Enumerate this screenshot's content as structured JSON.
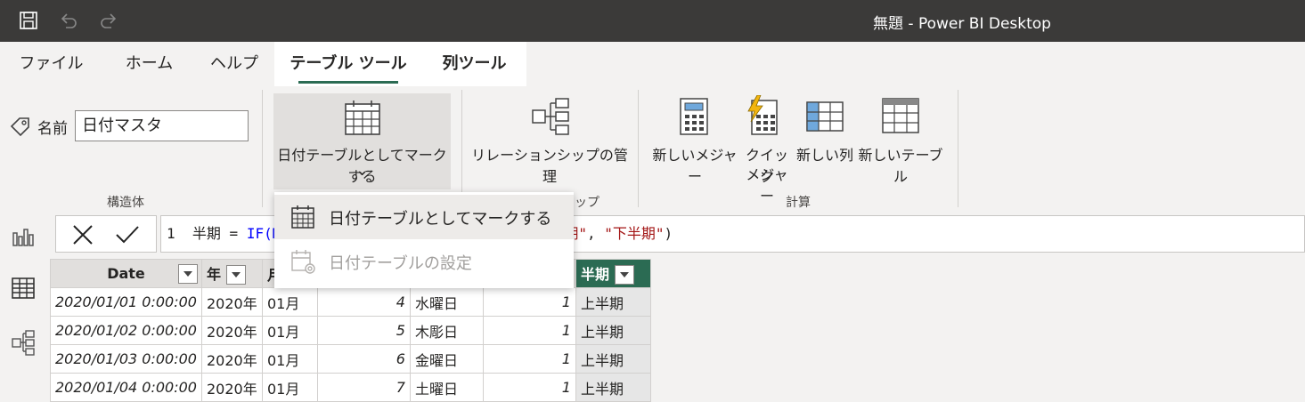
{
  "titlebar": {
    "title": "無題 - Power BI Desktop",
    "icons": [
      "save-icon",
      "undo-icon",
      "redo-icon"
    ]
  },
  "tabs": [
    {
      "label": "ファイル"
    },
    {
      "label": "ホーム"
    },
    {
      "label": "ヘルプ"
    },
    {
      "label": "テーブル ツール",
      "active": true
    },
    {
      "label": "列ツール"
    }
  ],
  "ribbon": {
    "structure": {
      "name_label": "名前",
      "name_value": "日付マスタ",
      "group_label": "構造体"
    },
    "calendar": {
      "mark_button": "日付テーブルとしてマークする",
      "chevron": "⌄"
    },
    "relationships": {
      "manage_button": "リレーションシップの管理",
      "group_label_partial": "ップ"
    },
    "calculations": {
      "new_measure": "新しいメジャー",
      "quick_measure_line1": "クイック",
      "quick_measure_line2": "メジャー",
      "new_column": "新しい列",
      "new_table": "新しいテーブル",
      "group_label": "計算"
    }
  },
  "dropdown_menu": {
    "items": [
      {
        "label": "日付テーブルとしてマークする",
        "enabled": true,
        "icon": "calendar-icon"
      },
      {
        "label": "日付テーブルの設定",
        "enabled": false,
        "icon": "date-settings-icon"
      }
    ]
  },
  "formula_bar": {
    "line_number": "1",
    "text_prefix": "半期 = ",
    "func": "IF(M",
    "text_tail_str1": "期\"",
    "text_tail_sep": ", ",
    "text_tail_str2": "\"下半期\"",
    "text_end": ")"
  },
  "leftnav": [
    "report-view-icon",
    "data-view-icon",
    "model-view-icon"
  ],
  "table": {
    "headers": [
      "Date",
      "年",
      "月",
      "",
      "",
      "",
      "半期"
    ],
    "rows": [
      [
        "2020/01/01 0:00:00",
        "2020年",
        "01月",
        "4",
        "水曜日",
        "1",
        "上半期"
      ],
      [
        "2020/01/02 0:00:00",
        "2020年",
        "01月",
        "5",
        "木彫日",
        "1",
        "上半期"
      ],
      [
        "2020/01/03 0:00:00",
        "2020年",
        "01月",
        "6",
        "金曜日",
        "1",
        "上半期"
      ],
      [
        "2020/01/04 0:00:00",
        "2020年",
        "01月",
        "7",
        "土曜日",
        "1",
        "上半期"
      ]
    ]
  },
  "colors": {
    "titlebar": "#3b3a39",
    "accent": "#2b6b53",
    "ribbon": "#f3f2f1"
  }
}
